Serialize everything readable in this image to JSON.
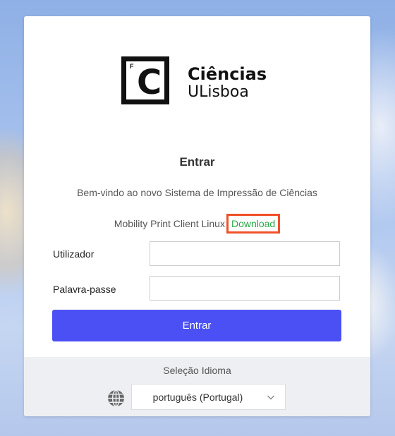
{
  "brand": {
    "logo_letter": "C",
    "logo_small_letter": "F",
    "line1": "Ciências",
    "line2": "ULisboa"
  },
  "login": {
    "title": "Entrar",
    "welcome": "Bem-vindo ao novo Sistema de Impressão de Ciências",
    "client_text": "Mobility Print Client Linux",
    "download_label": "Download",
    "username_label": "Utilizador",
    "username_value": "",
    "password_label": "Palavra-passe",
    "password_value": "",
    "submit_label": "Entrar"
  },
  "language": {
    "title": "Seleção Idioma",
    "selected": "português (Portugal)",
    "icon": "globe-icon"
  },
  "colors": {
    "accent": "#4a50f4",
    "link": "#27a745",
    "highlight": "#f0502a"
  }
}
